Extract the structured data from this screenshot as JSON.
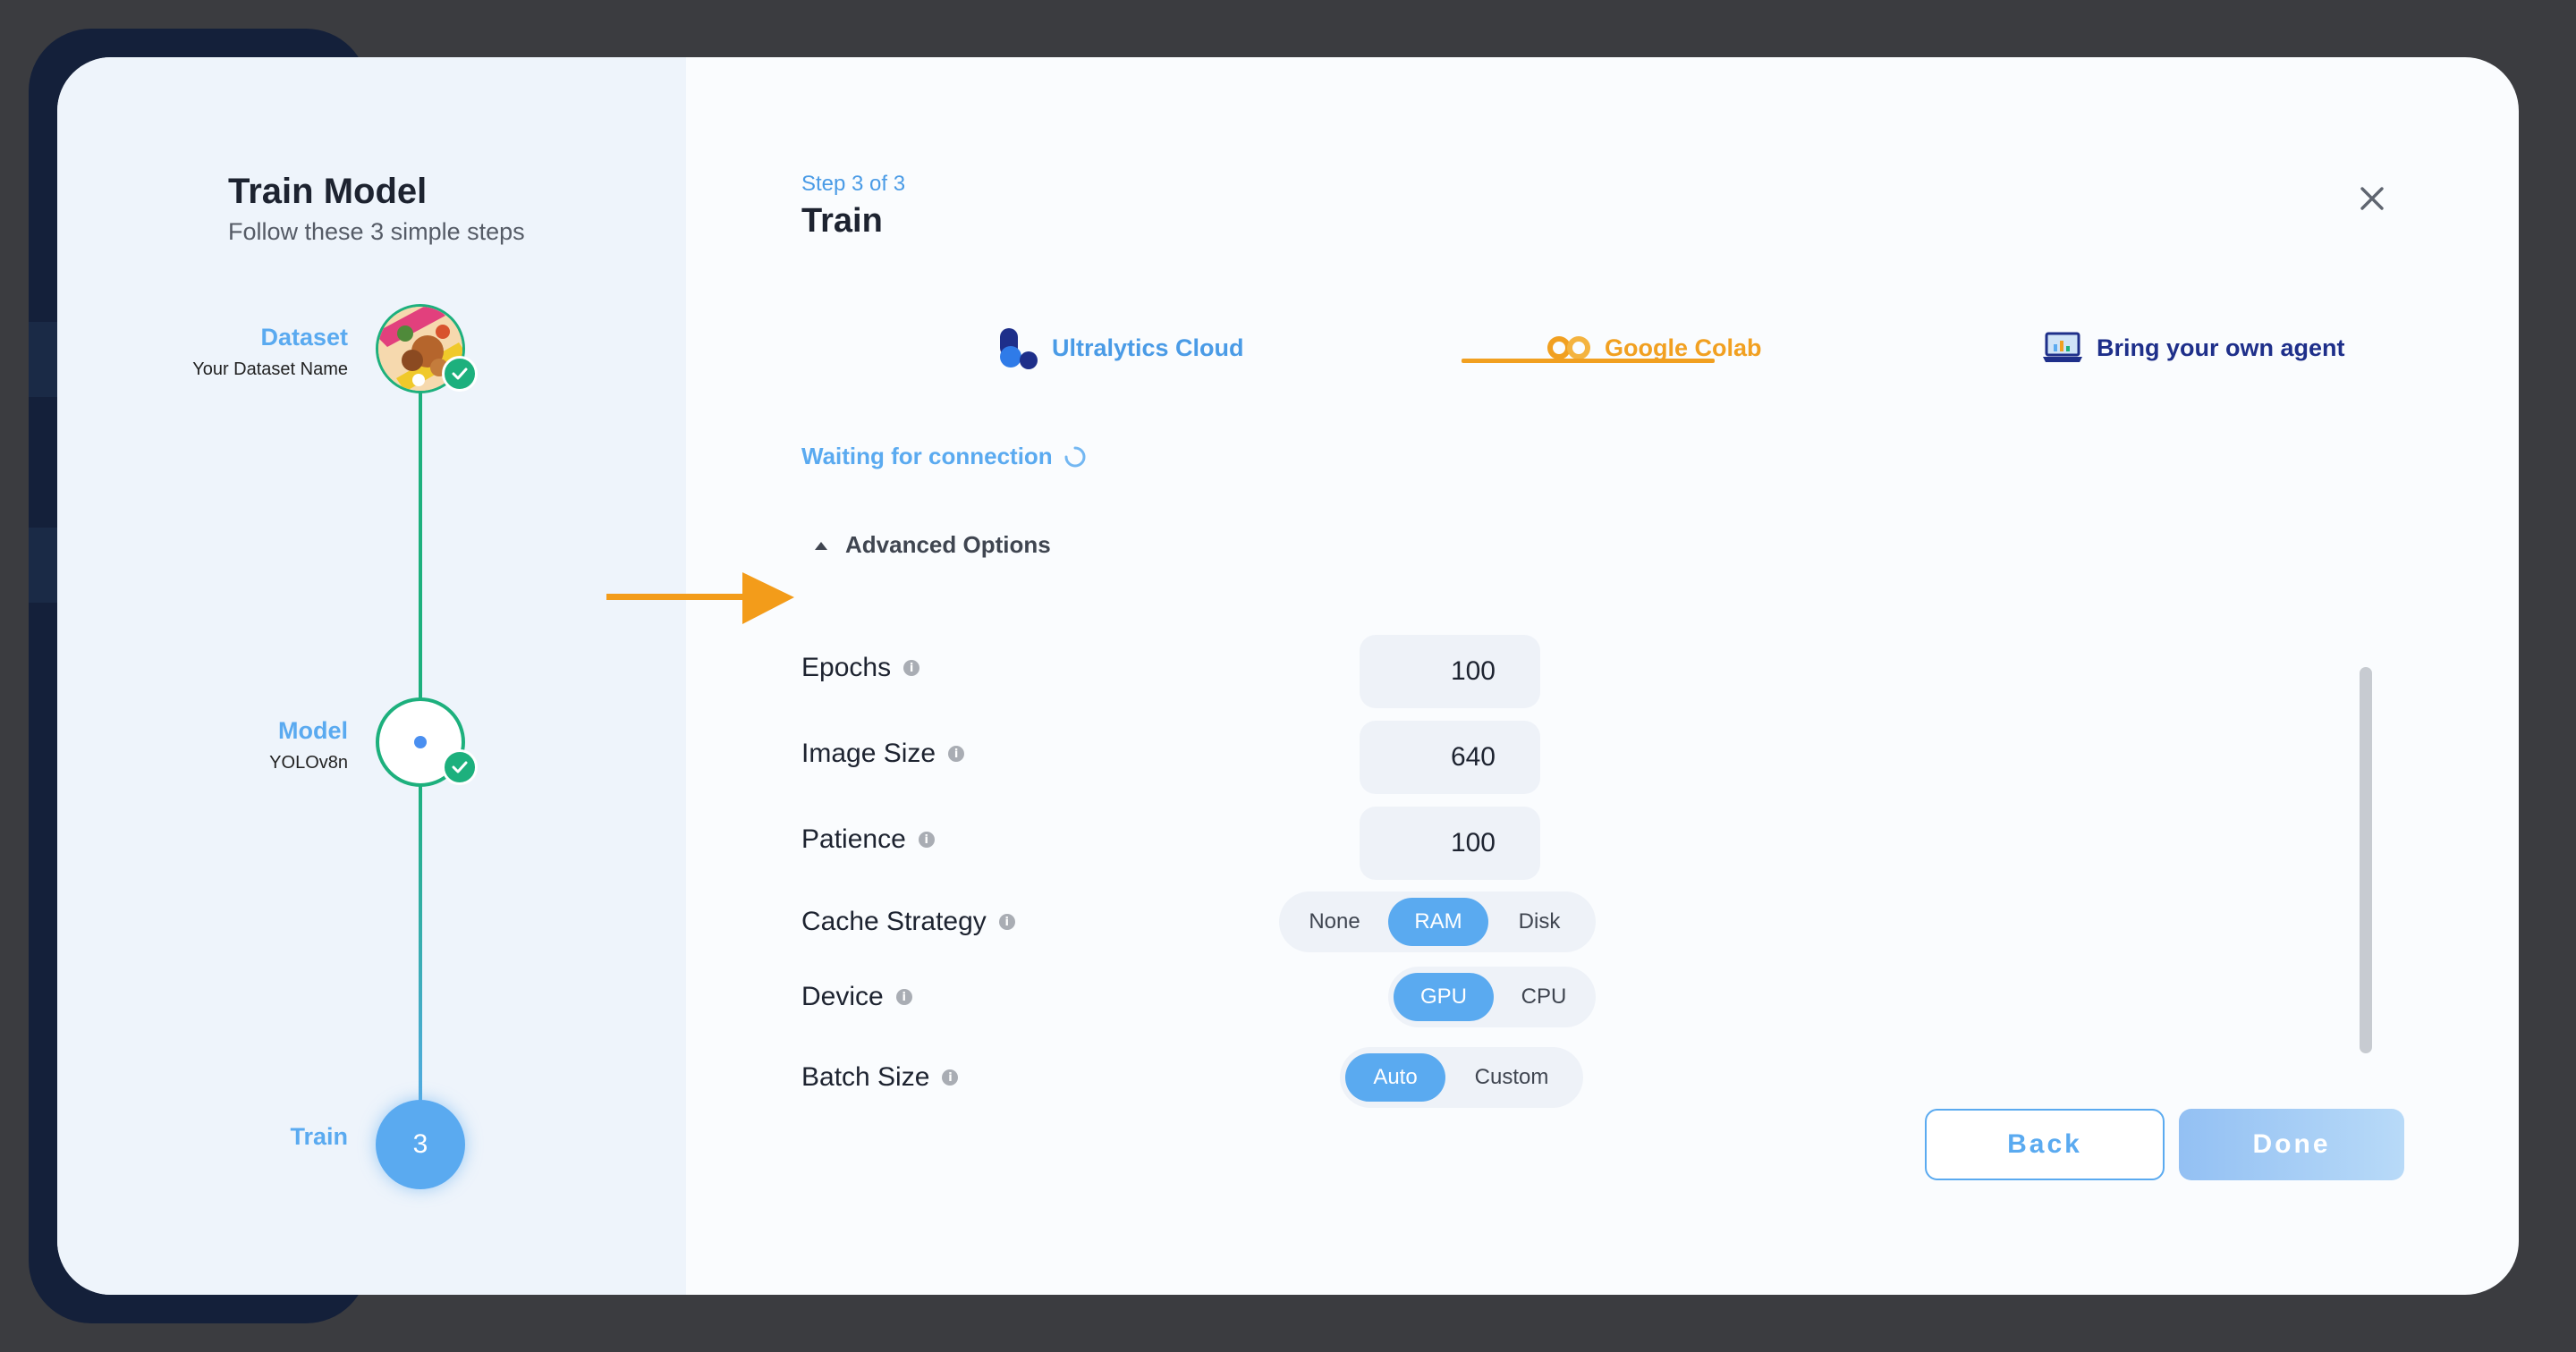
{
  "colors": {
    "accent": "#5aaaf0",
    "colab_orange": "#f1a021",
    "success": "#1db07d",
    "ultralytics_navy": "#1e2f8a"
  },
  "sidebar": {
    "title": "Train Model",
    "subtitle": "Follow these 3 simple steps",
    "steps": [
      {
        "label": "Dataset",
        "sub": "Your Dataset Name",
        "state": "complete"
      },
      {
        "label": "Model",
        "sub": "YOLOv8n",
        "state": "complete"
      },
      {
        "label": "Train",
        "number": "3",
        "state": "current"
      }
    ]
  },
  "header": {
    "step_counter": "Step 3 of 3",
    "title": "Train",
    "close_icon": "close-icon"
  },
  "tabs": [
    {
      "label": "Ultralytics Cloud",
      "icon": "ultralytics-logo-icon",
      "active": false
    },
    {
      "label": "Google Colab",
      "icon": "colab-logo-icon",
      "active": true
    },
    {
      "label": "Bring your own agent",
      "icon": "laptop-icon",
      "active": false
    }
  ],
  "status": {
    "waiting": "Waiting for connection"
  },
  "advanced": {
    "toggle_label": "Advanced Options",
    "expanded": true,
    "fields": {
      "epochs": {
        "label": "Epochs",
        "value": "100"
      },
      "image_size": {
        "label": "Image Size",
        "value": "640"
      },
      "patience": {
        "label": "Patience",
        "value": "100"
      },
      "cache": {
        "label": "Cache Strategy",
        "options": [
          "None",
          "RAM",
          "Disk"
        ],
        "selected": "RAM"
      },
      "device": {
        "label": "Device",
        "options": [
          "GPU",
          "CPU"
        ],
        "selected": "GPU"
      },
      "batch": {
        "label": "Batch Size",
        "options": [
          "Auto",
          "Custom"
        ],
        "selected": "Auto"
      }
    }
  },
  "footer": {
    "back_label": "Back",
    "done_label": "Done"
  }
}
